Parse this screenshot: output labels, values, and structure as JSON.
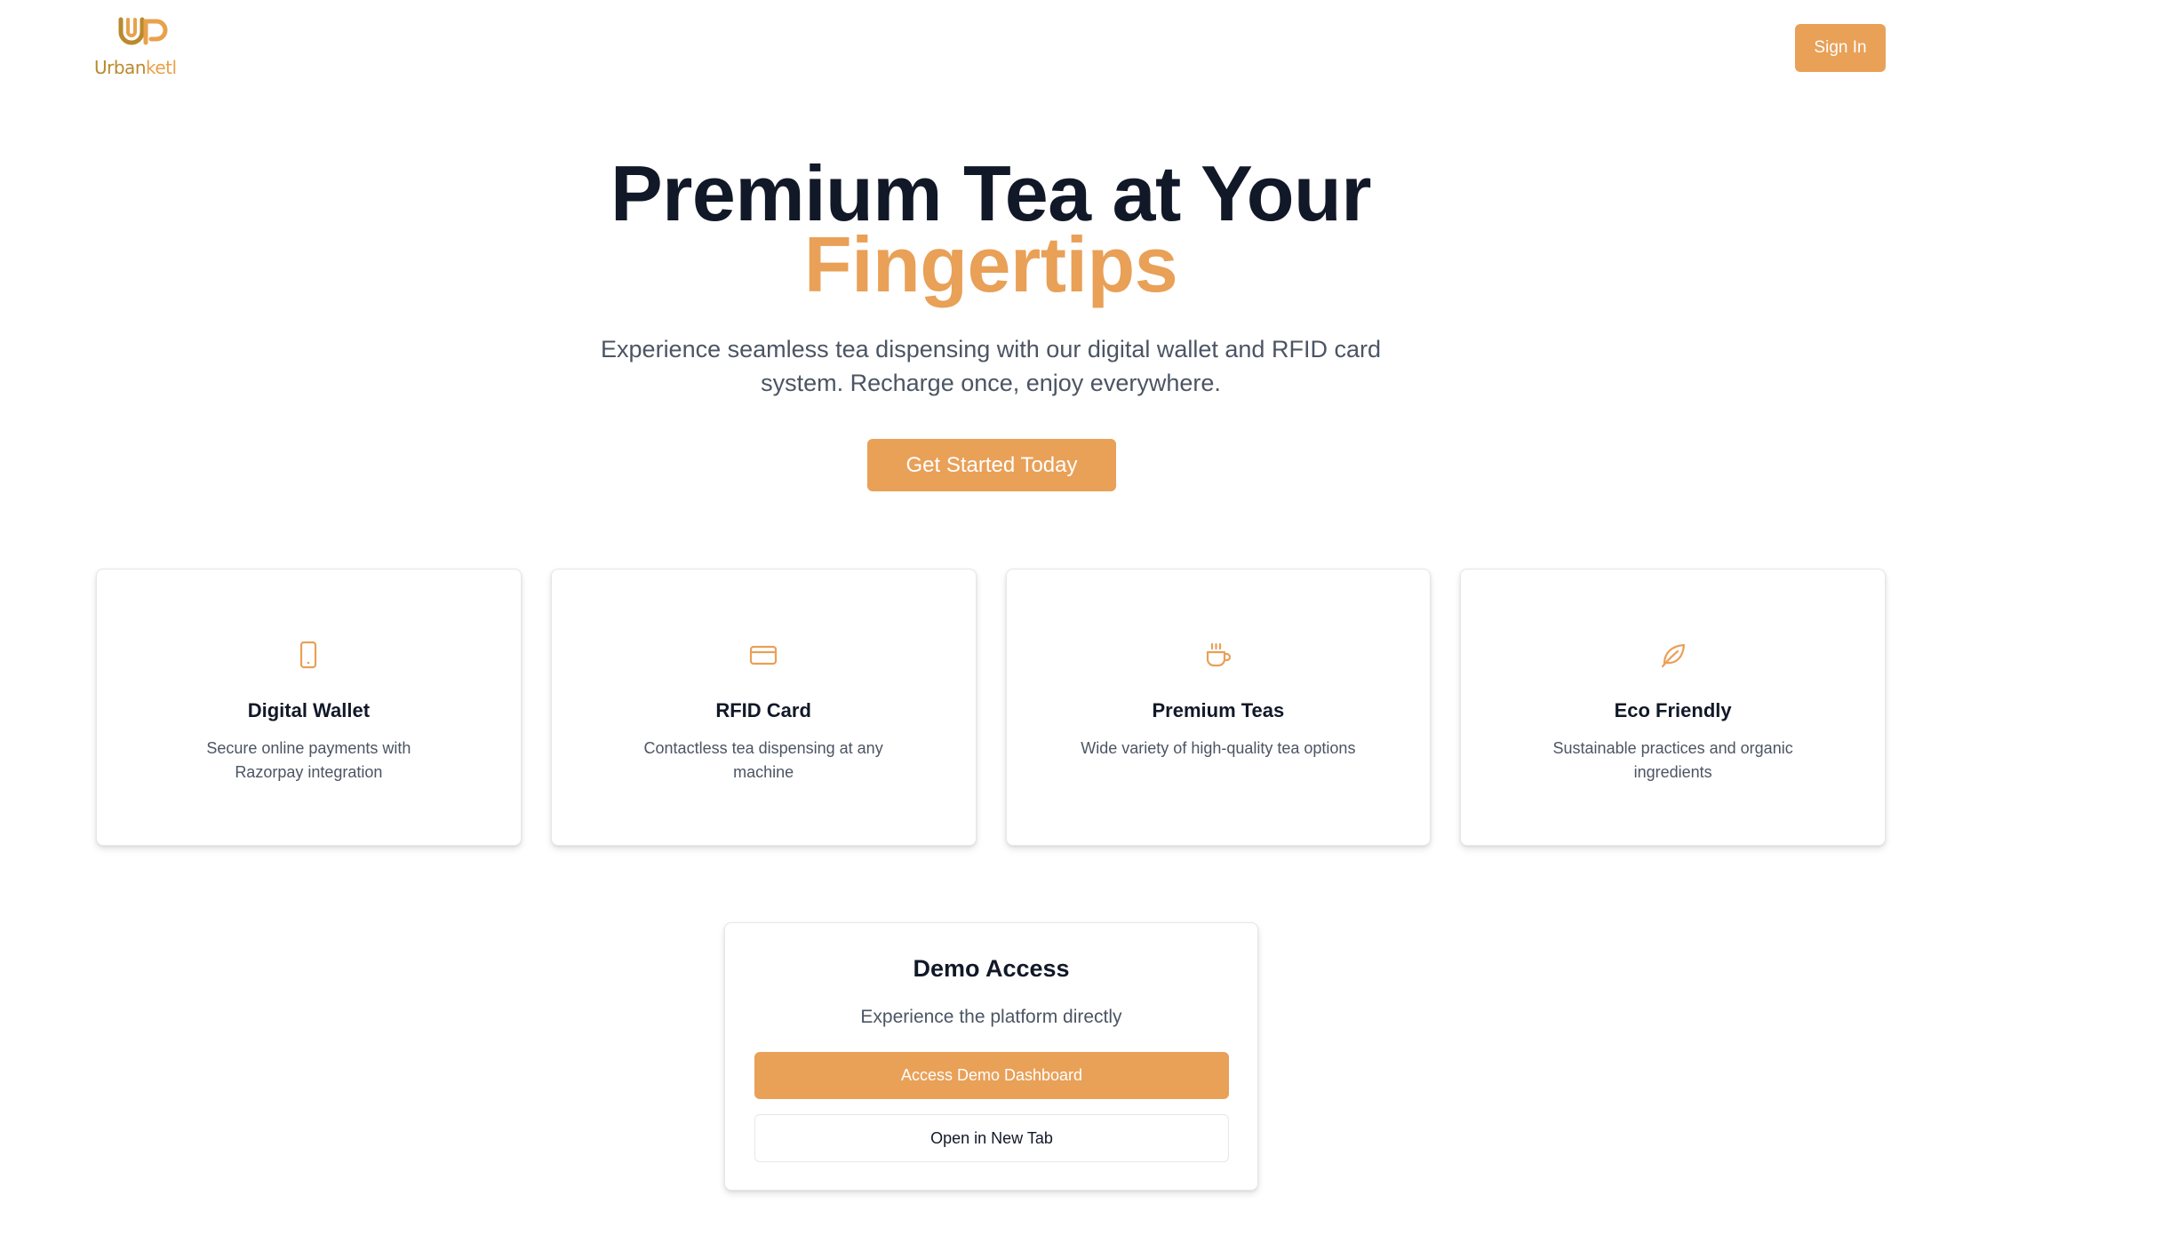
{
  "brand": {
    "logo_mark": "UP",
    "name_part1": "Urban",
    "name_part2": "ketl",
    "colors": {
      "primary": "#e9a057",
      "logo_gold": "#b98a2e",
      "heading": "#111827",
      "body": "#4b5563"
    }
  },
  "header": {
    "signin_label": "Sign In"
  },
  "hero": {
    "title_line1": "Premium Tea at Your",
    "title_line2": "Fingertips",
    "subtitle": "Experience seamless tea dispensing with our digital wallet and RFID card system. Recharge once, enjoy everywhere.",
    "cta_label": "Get Started Today"
  },
  "features": [
    {
      "icon": "smartphone-icon",
      "title": "Digital Wallet",
      "description": "Secure online payments with Razorpay integration"
    },
    {
      "icon": "credit-card-icon",
      "title": "RFID Card",
      "description": "Contactless tea dispensing at any machine"
    },
    {
      "icon": "coffee-cup-icon",
      "title": "Premium Teas",
      "description": "Wide variety of high-quality tea options"
    },
    {
      "icon": "leaf-icon",
      "title": "Eco Friendly",
      "description": "Sustainable practices and organic ingredients"
    }
  ],
  "demo": {
    "title": "Demo Access",
    "subtitle": "Experience the platform directly",
    "primary_label": "Access Demo Dashboard",
    "secondary_label": "Open in New Tab"
  }
}
